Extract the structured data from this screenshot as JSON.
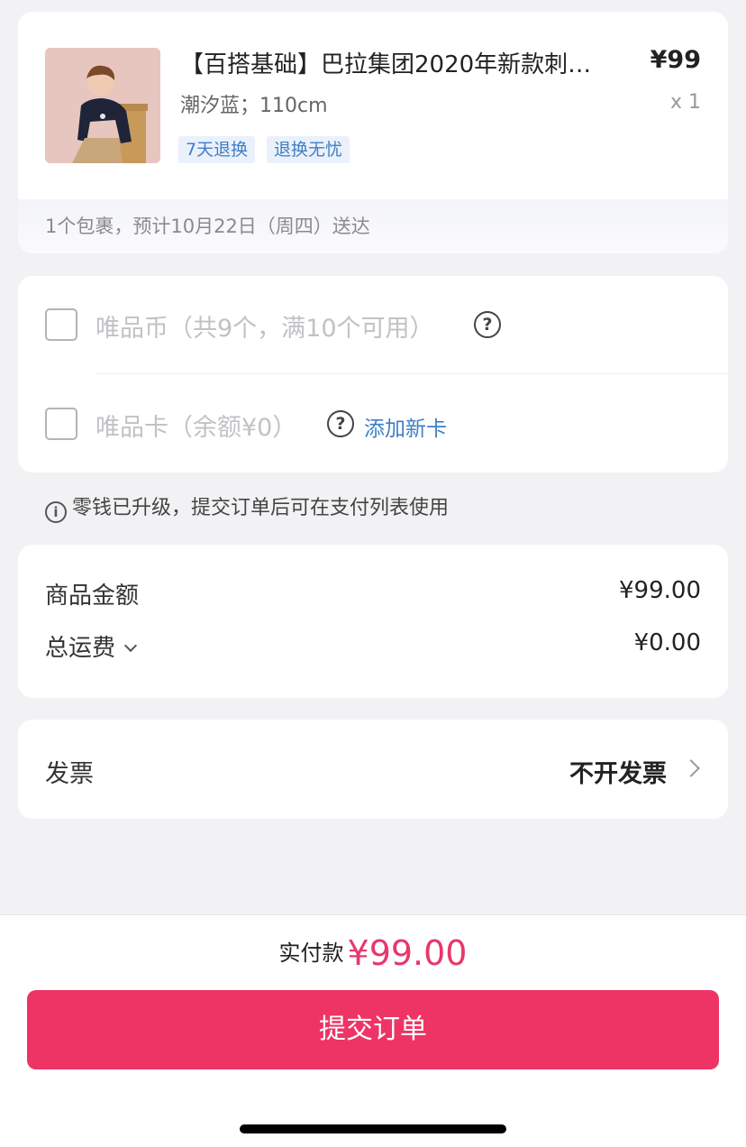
{
  "product": {
    "title": "【百搭基础】巴拉集团2020年新款刺…",
    "price": "¥99",
    "spec": "潮汐蓝；110cm",
    "quantity": "x 1",
    "tags": [
      "7天退换",
      "退换无忧"
    ],
    "delivery": "1个包裹，预计10月22日（周四）送达"
  },
  "vipcoin": {
    "label": "唯品币（共9个，满10个可用）",
    "checked": false
  },
  "vipcard": {
    "label": "唯品卡（余额¥0）",
    "add_card": "添加新卡",
    "checked": false
  },
  "notice": "零钱已升级，提交订单后可在支付列表使用",
  "summary": {
    "goods_label": "商品金额",
    "goods_value": "¥99.00",
    "shipping_label": "总运费",
    "shipping_value": "¥0.00"
  },
  "invoice": {
    "label": "发票",
    "value": "不开发票"
  },
  "footer": {
    "pay_label": "实付款",
    "pay_amount": "¥99.00",
    "submit": "提交订单"
  },
  "colors": {
    "accent": "#ee3465",
    "link": "#3f7fc6"
  }
}
